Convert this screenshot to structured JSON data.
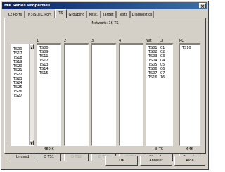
{
  "window": {
    "title": "MX Series Properties",
    "close_symbol": "×"
  },
  "tabs": [
    {
      "label": "Ct Ports"
    },
    {
      "label": "N3/SDTC Port"
    },
    {
      "label": "TS"
    },
    {
      "label": "Grouping"
    },
    {
      "label": "Misc."
    },
    {
      "label": "Target"
    },
    {
      "label": "Tests"
    },
    {
      "label": "Diagnostics"
    }
  ],
  "panel": {
    "network_label": "Network: 16 TS",
    "available": {
      "header": "",
      "items": [
        "TS00",
        "TS17",
        "TS18",
        "TS19",
        "TS20",
        "TS21",
        "TS22",
        "TS23",
        "TS24",
        "TS25",
        "TS26",
        "TS27"
      ]
    },
    "groups": [
      {
        "header": "1",
        "items": [
          "TS00",
          "TS09",
          "TS11",
          "TS12",
          "TS13",
          "TS14",
          "TS15"
        ]
      },
      {
        "header": "2",
        "items": []
      },
      {
        "header": "3",
        "items": []
      },
      {
        "header": "4",
        "items": []
      }
    ],
    "net_table": {
      "col_net": "Nat",
      "col_di": "DI",
      "rows": [
        {
          "net": "TS01",
          "di": "01"
        },
        {
          "net": "TS02",
          "di": "02"
        },
        {
          "net": "TS03",
          "di": "03"
        },
        {
          "net": "TS04",
          "di": "04"
        },
        {
          "net": "TS05",
          "di": "05"
        },
        {
          "net": "TS06",
          "di": "06"
        },
        {
          "net": "TS07",
          "di": "07"
        },
        {
          "net": "TS16",
          "di": "16"
        }
      ]
    },
    "rc": {
      "header": "RC",
      "items": [
        "TS10"
      ]
    },
    "counts": {
      "group1": "480 K",
      "net": "8 TS",
      "rc": "64K"
    },
    "buttons": {
      "unused": "Unused",
      "b1": "D TS1",
      "b2": "D TS2",
      "b3": "D TS3",
      "b4": "D TS4",
      "chop_assoc": "Chop Assoc",
      "remove": "Remote"
    }
  },
  "footer": {
    "ok": "OK",
    "cancel": "Annuler",
    "help": "Aide"
  }
}
